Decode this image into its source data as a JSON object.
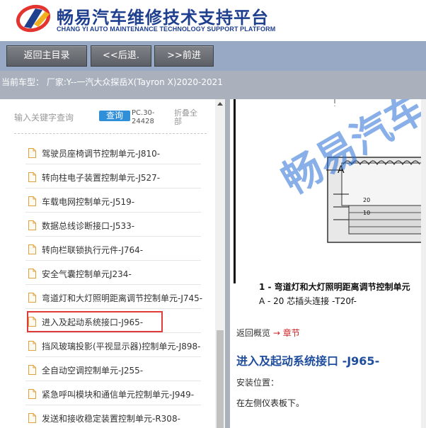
{
  "header": {
    "brand_cn": "畅易汽车维修技术支持平台",
    "brand_en": "CHANG YI AUTO MAINTENANCE TECHNOLOGY SUPPORT PLATFORM",
    "logo_icon": "cy-logo-icon"
  },
  "toolbar": {
    "home_label": "返回主目录",
    "back_label": "<<后退.",
    "forward_label": ">>前进"
  },
  "car_info": {
    "text": "当前车型： 厂家:Y--一汽大众探岳X(Tayron X)2020-2021"
  },
  "search": {
    "placeholder": "输入关键字查询",
    "button_label": "查询",
    "pc_code": "PC.30-\n24428",
    "collapse_label": "折叠全部"
  },
  "tree": {
    "items": [
      {
        "label": "驾驶员座椅调节控制单元-J810-"
      },
      {
        "label": "转向柱电子装置控制单元-J527-"
      },
      {
        "label": "车载电网控制单元-J519-"
      },
      {
        "label": "数据总线诊断接口-J533-"
      },
      {
        "label": "转向栏联锁执行元件-J764-"
      },
      {
        "label": "安全气囊控制单元J234-"
      },
      {
        "label": "弯道灯和大灯照明距离调节控制单元-J745-"
      },
      {
        "label": "进入及起动系统接口-J965-"
      },
      {
        "label": "挡风玻璃投影(平视显示器)控制单元-J898-"
      },
      {
        "label": "全自动空调控制单元-J255-"
      },
      {
        "label": "紧急呼叫模块和通信单元控制单元-J949-"
      },
      {
        "label": "发送和接收稳定装置控制单元-R308-"
      }
    ],
    "selected_index": 7
  },
  "diagram": {
    "label_a": "A",
    "label_20": "20",
    "label_10": "10",
    "caption_1": "1 - 弯道灯和大灯照明距离调节控制单元",
    "caption_2": "A - 20 芯插头连接 -T20f-",
    "watermark": "畅易汽车"
  },
  "content": {
    "overview_label": "返回概览",
    "overview_arrow": "→",
    "overview_chapter": "章节",
    "title": "进入及起动系统接口 -J965-",
    "location_label": "安装位置：",
    "location_text": "在左侧仪表板下。"
  },
  "colors": {
    "brand": "#1f3f8f",
    "toolbar_bg": "#97a9c4",
    "button": "#5c6066",
    "search_button": "#2f8fd8",
    "highlight": "#e03a3a",
    "title": "#1f4d9e"
  }
}
